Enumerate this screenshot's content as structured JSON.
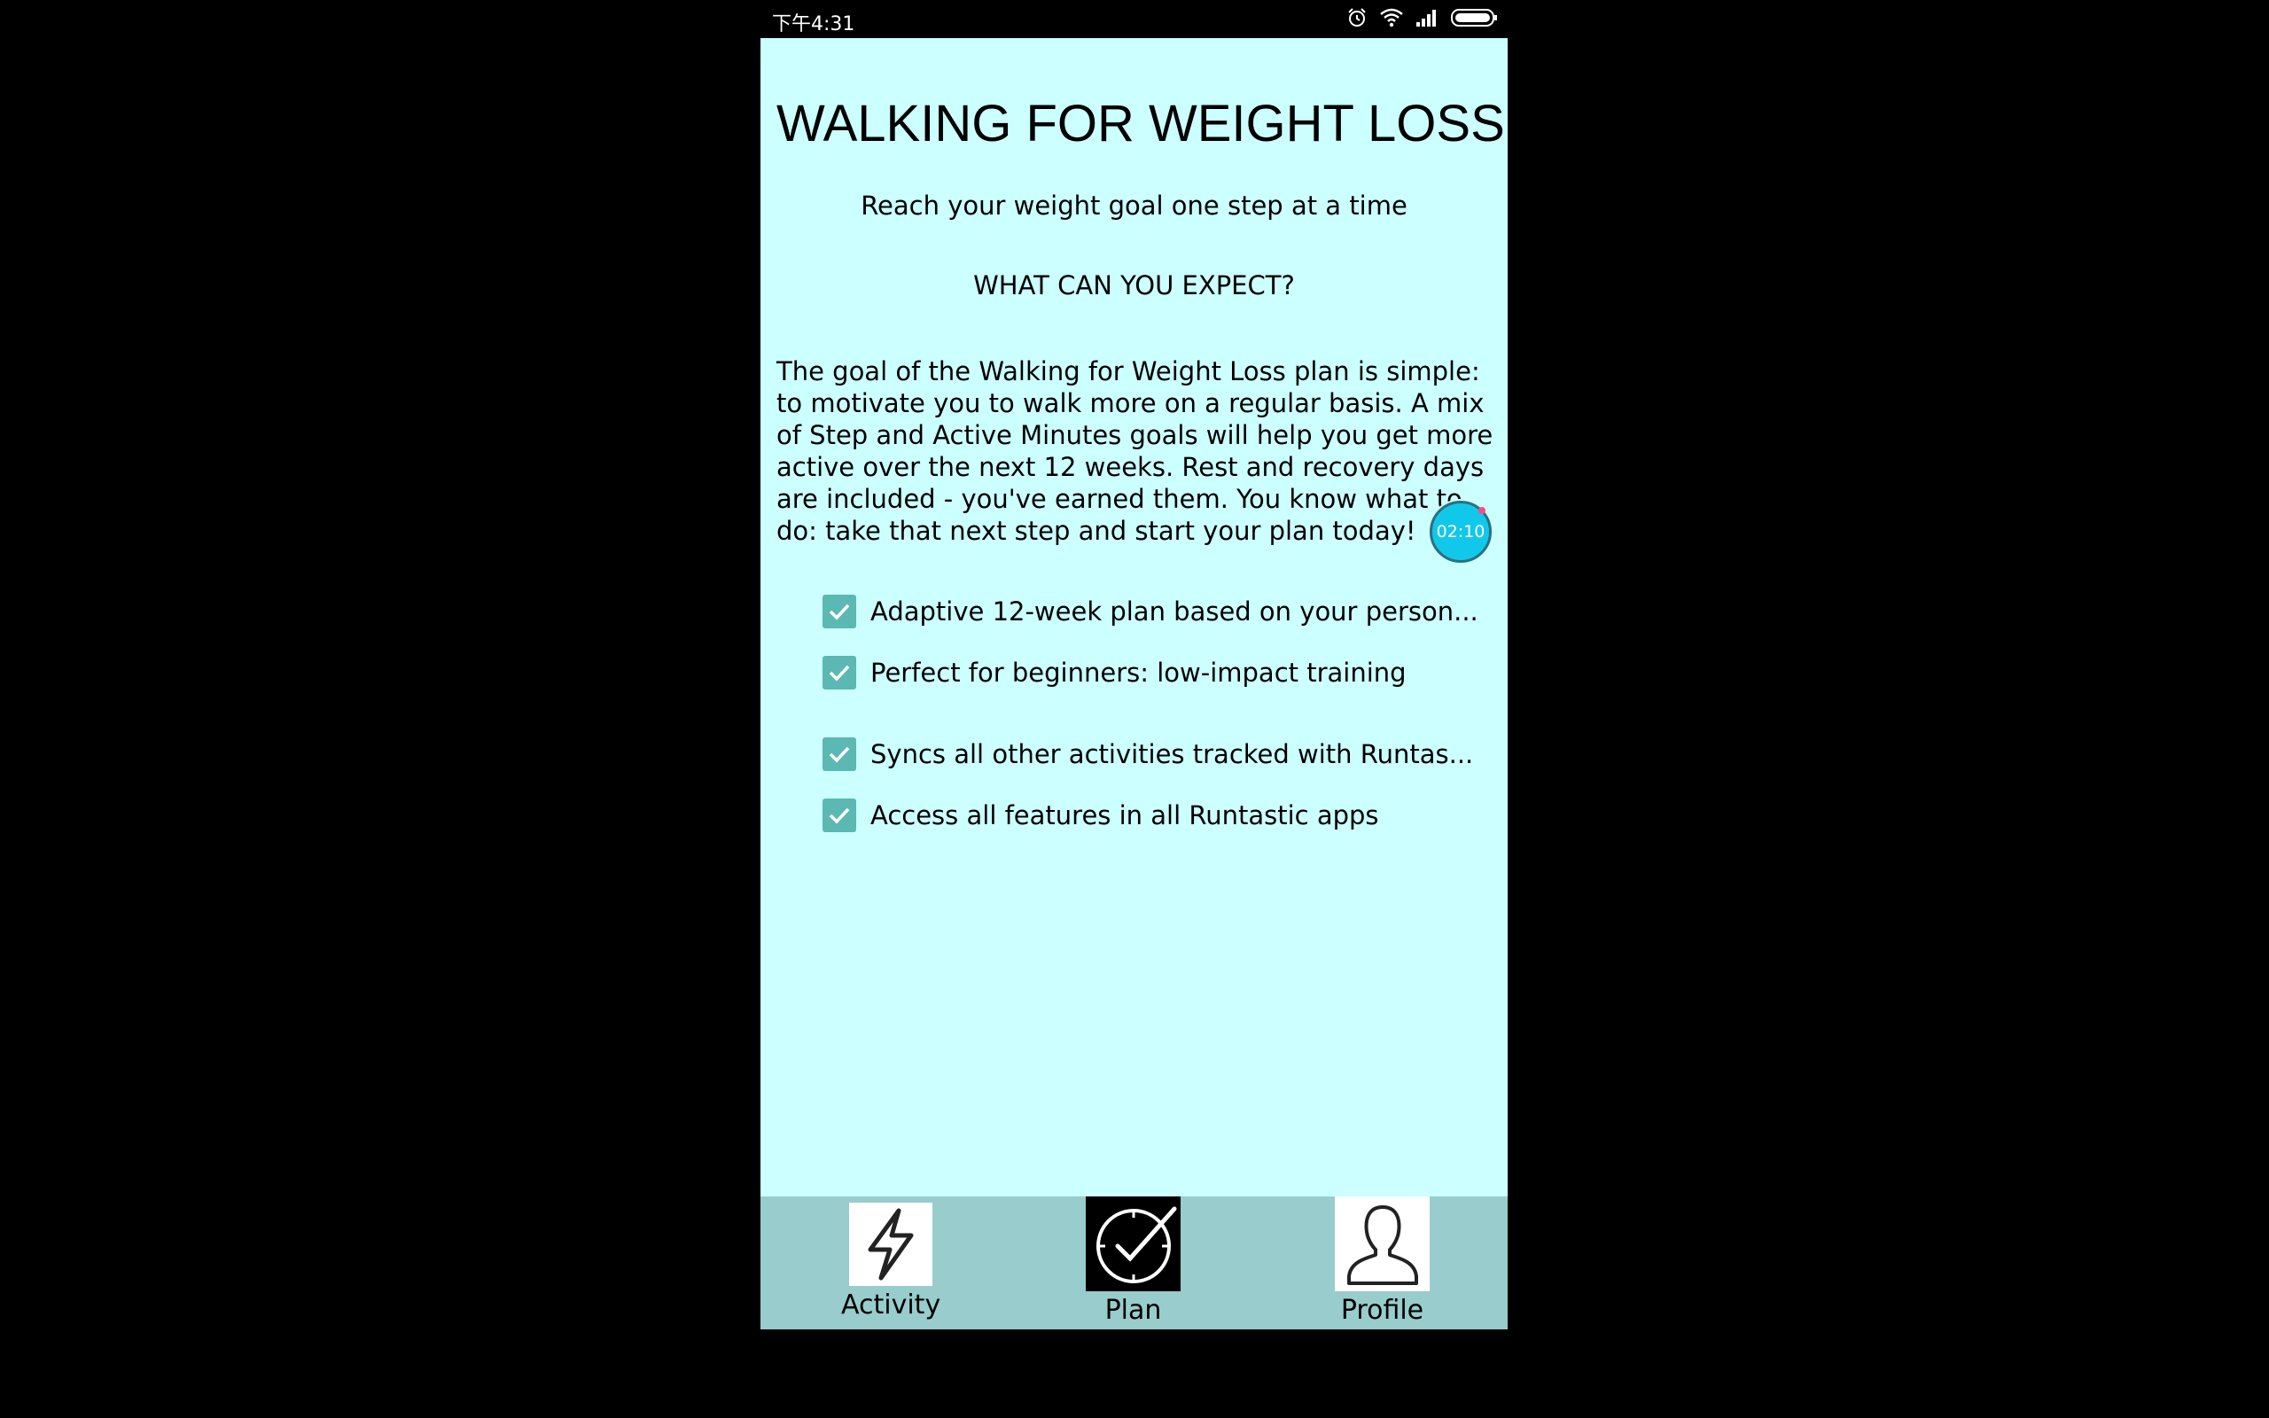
{
  "status_bar": {
    "time": "下午4:31",
    "icons": [
      "alarm-icon",
      "wifi-icon",
      "signal-icon",
      "battery-icon"
    ]
  },
  "page": {
    "title": "WALKING FOR WEIGHT LOSS",
    "subtitle": "Reach your weight goal one step at a time",
    "section_heading": "WHAT CAN YOU EXPECT?",
    "description": "The goal of the Walking for Weight Loss plan is simple: to motivate you to walk more on a regular basis. A mix of Step and Active Minutes goals will help you get more active over the next 12 weeks. Rest and recovery days are included - you've earned them. You know what to do: take that next step and start your plan today!"
  },
  "features": [
    {
      "label": "Adaptive 12-week plan based on your person...",
      "checked": true
    },
    {
      "label": "Perfect for beginners: low-impact training",
      "checked": true
    },
    {
      "label": "Syncs all other activities tracked with Runtas...",
      "checked": true
    },
    {
      "label": "Access all features in all Runtastic apps",
      "checked": true
    }
  ],
  "timer": {
    "value": "02:10"
  },
  "bottom_nav": {
    "items": [
      {
        "label": "Activity",
        "icon": "lightning-icon"
      },
      {
        "label": "Plan",
        "icon": "clock-check-icon",
        "active": true
      },
      {
        "label": "Profile",
        "icon": "person-icon"
      }
    ]
  },
  "colors": {
    "screen_background": "#ccffff",
    "nav_background": "#99cccc",
    "checkbox": "#5cb8b2",
    "timer": "#12c8ea"
  }
}
